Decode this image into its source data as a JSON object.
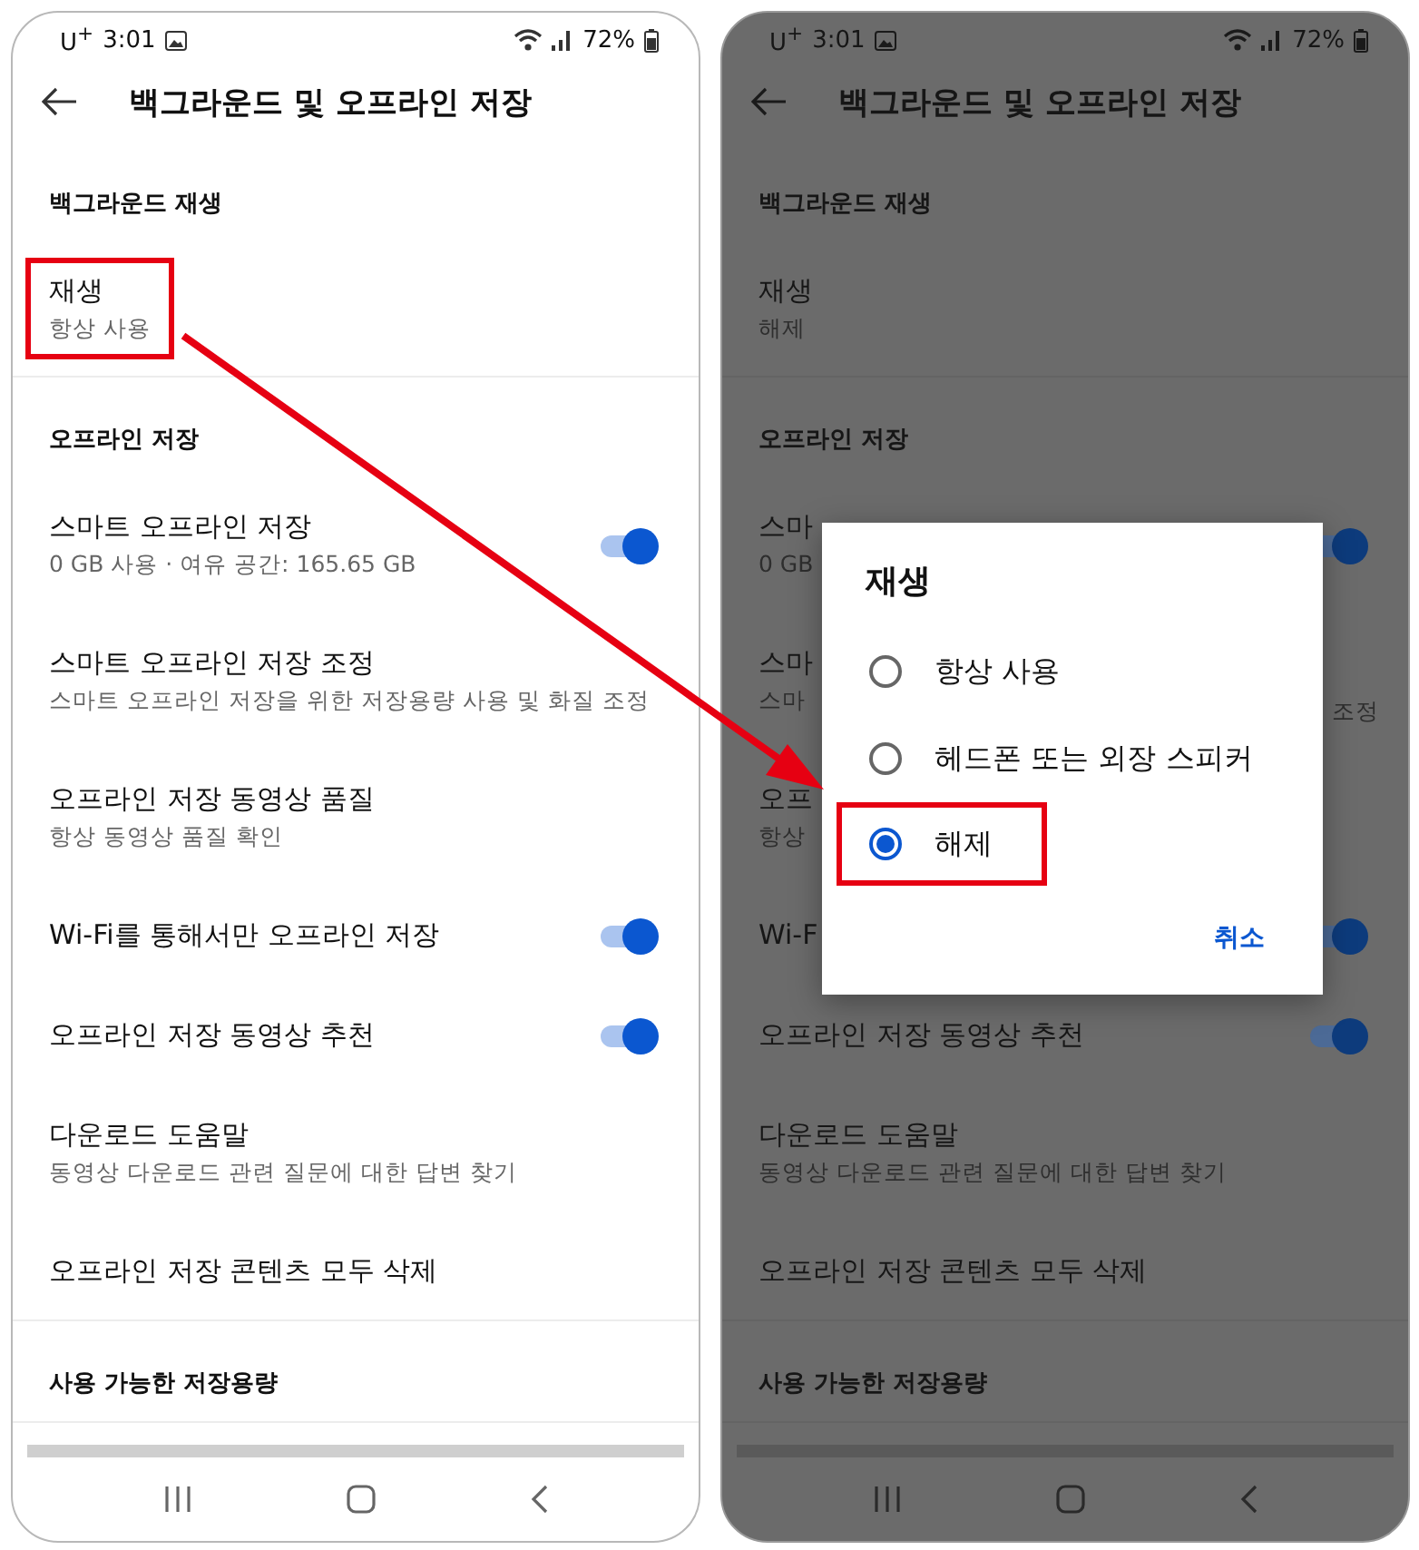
{
  "phones": [
    {
      "dimmed": false,
      "status": {
        "carrier": "U$^{+}$",
        "time": "3:01",
        "battery": "72%"
      },
      "title": "백그라운드 및 오프라인 저장",
      "sections": [
        {
          "header": "백그라운드 재생",
          "items": [
            {
              "title": "재생",
              "subtitle": "항상 사용",
              "highlighted": true
            }
          ]
        },
        {
          "header": "오프라인 저장",
          "items": [
            {
              "title": "스마트 오프라인 저장",
              "subtitle": "0 GB 사용 · 여유 공간: 165.65 GB",
              "on": true
            },
            {
              "title": "스마트 오프라인 저장 조정",
              "subtitle": "스마트 오프라인 저장을 위한 저장용량 사용 및 화질 조정"
            },
            {
              "title": "오프라인 저장 동영상 품질",
              "subtitle": "항상 동영상 품질 확인"
            },
            {
              "title": "Wi-Fi를 통해서만 오프라인 저장",
              "on": true
            },
            {
              "title": "오프라인 저장 동영상 추천",
              "on": true
            },
            {
              "title": "다운로드 도움말",
              "subtitle": "동영상 다운로드 관련 질문에 대한 답변 찾기"
            },
            {
              "title": "오프라인 저장 콘텐츠 모두 삭제"
            }
          ]
        },
        {
          "header": "사용 가능한 저장용량"
        }
      ]
    },
    {
      "dimmed": true,
      "status": {
        "carrier": "U$^{+}$",
        "time": "3:01",
        "battery": "72%"
      },
      "title": "백그라운드 및 오프라인 저장",
      "sections": [
        {
          "header": "백그라운드 재생",
          "items": [
            {
              "title": "재생",
              "subtitle": "해제",
              "highlighted": false
            }
          ]
        },
        {
          "header": "오프라인 저장",
          "items": [
            {
              "title": "스마",
              "subtitle": "0 GB",
              "on": true
            },
            {
              "title": "스마",
              "subtitle": "스마",
              "subtitle_tail": "조정"
            },
            {
              "title": "오프",
              "subtitle": "항상"
            },
            {
              "title": "Wi-F",
              "on": true
            },
            {
              "title": "오프라인 저장 동영상 추천",
              "on": true
            },
            {
              "title": "다운로드 도움말",
              "subtitle": "동영상 다운로드 관련 질문에 대한 답변 찾기"
            },
            {
              "title": "오프라인 저장 콘텐츠 모두 삭제"
            }
          ]
        },
        {
          "header": "사용 가능한 저장용량"
        }
      ],
      "dialog": {
        "title": "재생",
        "options": [
          {
            "label": "항상 사용",
            "selected": false,
            "highlighted": false
          },
          {
            "label": "헤드폰 또는 외장 스피커",
            "selected": false,
            "highlighted": false
          },
          {
            "label": "해제",
            "selected": true,
            "highlighted": true
          }
        ],
        "cancel": "취소"
      }
    }
  ]
}
